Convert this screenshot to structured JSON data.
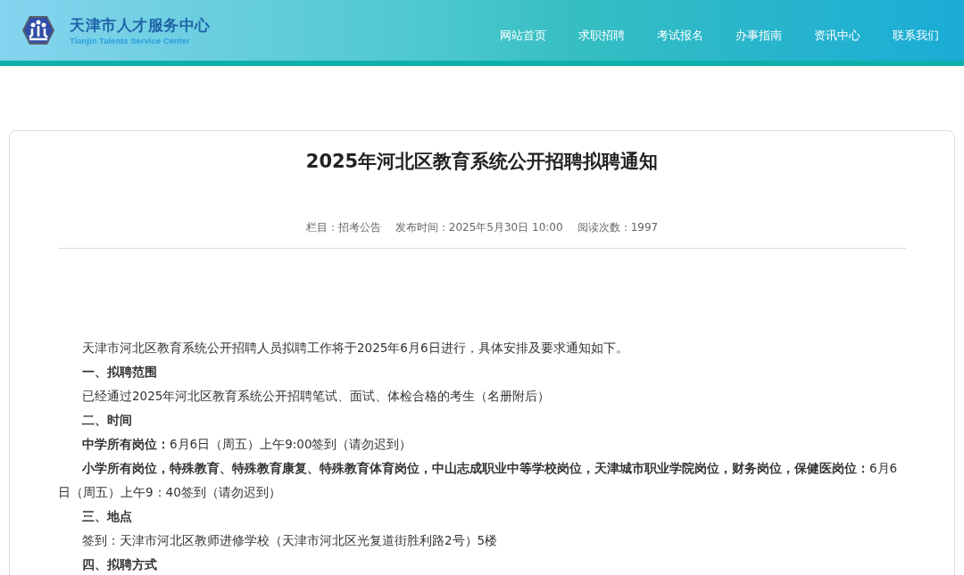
{
  "header": {
    "site_name": "天津市人才服务中心",
    "site_name_en": "Tianjin Talents Service Center",
    "nav": [
      {
        "label": "网站首页"
      },
      {
        "label": "求职招聘"
      },
      {
        "label": "考试报名"
      },
      {
        "label": "办事指南"
      },
      {
        "label": "资讯中心"
      },
      {
        "label": "联系我们"
      }
    ]
  },
  "article": {
    "title": "2025年河北区教育系统公开招聘拟聘通知",
    "meta": [
      "栏目：招考公告",
      "发布时间：2025年5月30日 10:00",
      "阅读次数：1997"
    ],
    "paragraphs": [
      {
        "kind": "text",
        "text": "天津市河北区教育系统公开招聘人员拟聘工作将于2025年6月6日进行，具体安排及要求通知如下。"
      },
      {
        "kind": "heading",
        "text": "一、拟聘范围"
      },
      {
        "kind": "text",
        "text": "已经通过2025年河北区教育系统公开招聘笔试、面试、体检合格的考生（名册附后）"
      },
      {
        "kind": "heading",
        "text": "二、时间"
      },
      {
        "kind": "text",
        "text": "**中学所有岗位：**6月6日（周五）上午9:00签到（请勿迟到）"
      },
      {
        "kind": "text",
        "text": "**小学所有岗位，特殊教育、特殊教育康复、特殊教育体育岗位，中山志成职业中等学校岗位，天津城市职业学院岗位，财务岗位，保健医岗位：**6月6日（周五）上午9：40签到（请勿迟到）"
      },
      {
        "kind": "heading",
        "text": "三、地点"
      },
      {
        "kind": "text",
        "text": "签到：天津市河北区教师进修学校（天津市河北区光复道街胜利路2号）5楼"
      },
      {
        "kind": "heading",
        "text": "四、拟聘方式"
      }
    ]
  }
}
